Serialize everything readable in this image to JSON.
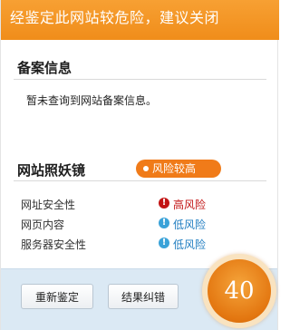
{
  "header": {
    "warning_text": "经鉴定此网站较危险，建议关闭"
  },
  "record_section": {
    "title": "备案信息",
    "message": "暂未查询到网站备案信息。"
  },
  "mirror_section": {
    "title": "网站照妖镜",
    "risk_badge": "风险较高",
    "rows": [
      {
        "label": "网址安全性",
        "status": "高风险",
        "icon": "exclamation-icon",
        "level": "high"
      },
      {
        "label": "网页内容",
        "status": "低风险",
        "icon": "exclamation-icon",
        "level": "low"
      },
      {
        "label": "服务器安全性",
        "status": "低风险",
        "icon": "exclamation-icon",
        "level": "low"
      }
    ]
  },
  "footer": {
    "recheck_label": "重新鉴定",
    "correct_label": "结果纠错",
    "score": "40"
  },
  "colors": {
    "header_orange": "#f08d1a",
    "high_risk_red": "#c21414",
    "low_risk_blue": "#1e7cc0",
    "footer_bg": "#dbe9f4"
  }
}
